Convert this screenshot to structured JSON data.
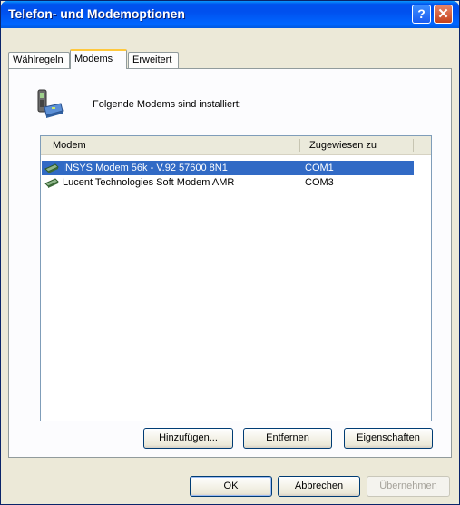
{
  "window": {
    "title": "Telefon- und Modemoptionen",
    "help_button": "?",
    "close_button": "✕"
  },
  "tabs": [
    {
      "label": "Wählregeln",
      "active": false
    },
    {
      "label": "Modems",
      "active": true
    },
    {
      "label": "Erweitert",
      "active": false
    }
  ],
  "panel": {
    "heading": "Folgende Modems sind installiert:",
    "icon": "phone-modem-icon"
  },
  "table": {
    "columns": [
      "Modem",
      "Zugewiesen zu"
    ],
    "rows": [
      {
        "modem": "INSYS Modem 56k - V.92 57600 8N1",
        "port": "COM1",
        "selected": true,
        "icon": "modem-icon"
      },
      {
        "modem": "Lucent Technologies Soft Modem AMR",
        "port": "COM3",
        "selected": false,
        "icon": "modem-icon"
      }
    ]
  },
  "panel_buttons": {
    "add": "Hinzufügen...",
    "remove": "Entfernen",
    "properties": "Eigenschaften"
  },
  "dialog_buttons": {
    "ok": "OK",
    "cancel": "Abbrechen",
    "apply": "Übernehmen",
    "apply_enabled": false
  },
  "colors": {
    "titlebar": "#0054e3",
    "selection": "#316ac5",
    "active_tab_accent": "#ffc83c"
  }
}
